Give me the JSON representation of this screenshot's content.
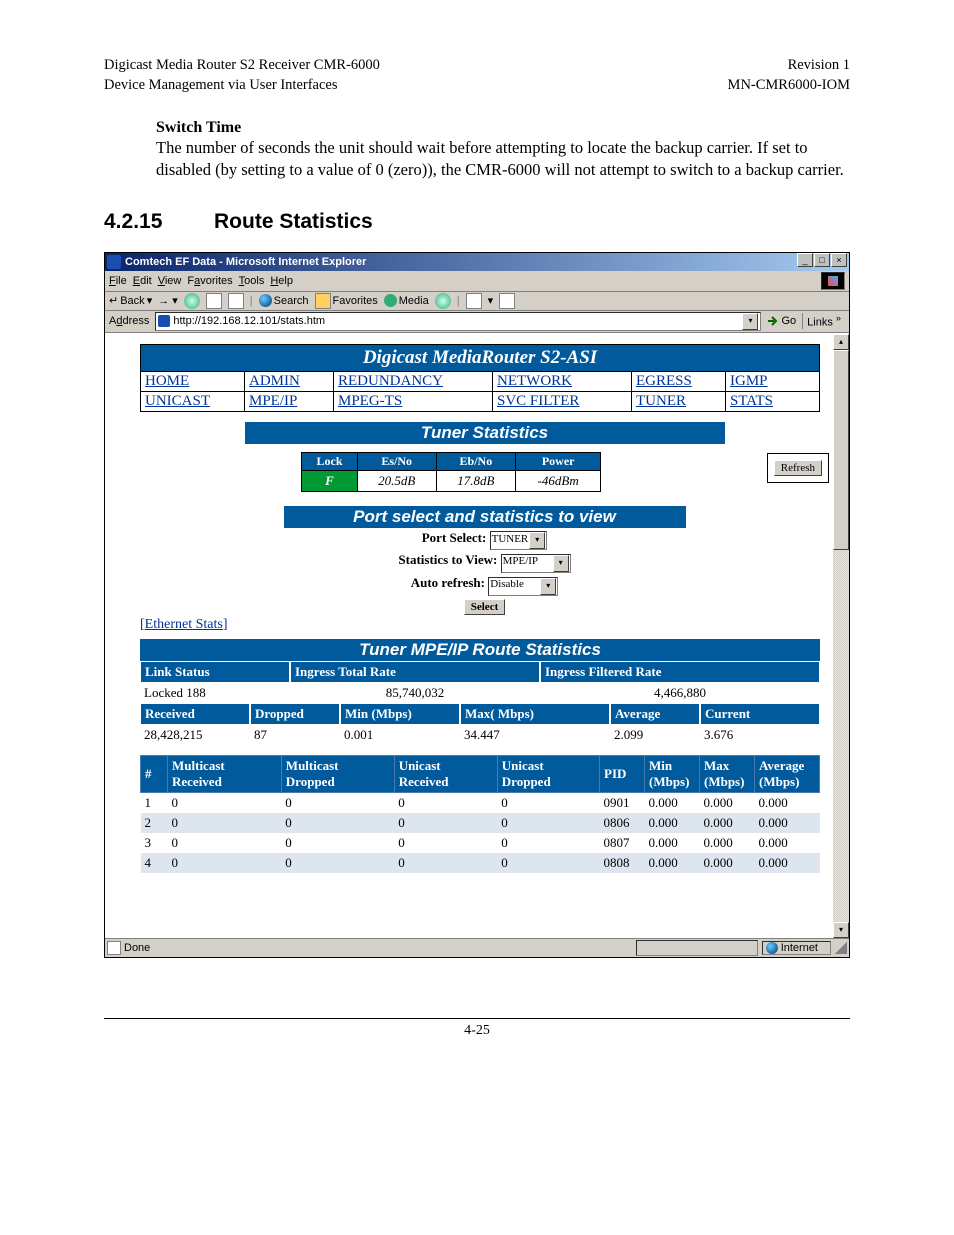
{
  "header": {
    "l1": "Digicast Media Router S2 Receiver CMR-6000",
    "l2": "Device Management via User Interfaces",
    "r1": "Revision 1",
    "r2": "MN-CMR6000-IOM"
  },
  "switch": {
    "title": "Switch Time",
    "body": "The number of seconds the unit should wait before attempting to locate the backup carrier. If set to disabled (by setting to a value of 0 (zero)), the CMR-6000 will not attempt to switch to a backup carrier."
  },
  "section": {
    "num": "4.2.15",
    "title": "Route Statistics"
  },
  "win": {
    "title": "Comtech EF Data - Microsoft Internet Explorer",
    "min": "_",
    "max": "□",
    "close": "×"
  },
  "menu": {
    "file": "File",
    "edit": "Edit",
    "view": "View",
    "fav": "Favorites",
    "tools": "Tools",
    "help": "Help"
  },
  "tb": {
    "back": "Back",
    "search": "Search",
    "fav": "Favorites",
    "media": "Media"
  },
  "addr": {
    "label": "Address",
    "url": "http://192.168.12.101/stats.htm",
    "go": "Go",
    "links": "Links"
  },
  "nav": {
    "title": "Digicast MediaRouter S2-ASI",
    "r1": [
      "HOME",
      "ADMIN",
      "REDUNDANCY",
      "NETWORK",
      "EGRESS",
      "IGMP"
    ],
    "r2": [
      "UNICAST",
      "MPE/IP",
      "MPEG-TS",
      "SVC FILTER",
      "TUNER",
      "STATS"
    ]
  },
  "tuner": {
    "title": "Tuner Statistics",
    "h": [
      "Lock",
      "Es/No",
      "Eb/No",
      "Power"
    ],
    "v": [
      "F",
      "20.5dB",
      "17.8dB",
      "-46dBm"
    ],
    "refresh": "Refresh"
  },
  "portsel": {
    "title": "Port select and statistics to view",
    "l1": "Port Select:",
    "v1": "TUNER",
    "l2": "Statistics to View:",
    "v2": "MPE/IP",
    "l3": "Auto refresh:",
    "v3": "Disable",
    "btn": "Select"
  },
  "ethlink": "Ethernet Stats",
  "routestats": {
    "title": "Tuner MPE/IP Route Statistics",
    "r1h": [
      "Link Status",
      "Ingress Total Rate",
      "Ingress Filtered Rate"
    ],
    "r1v": [
      "Locked 188",
      "85,740,032",
      "4,466,880"
    ],
    "r2h": [
      "Received",
      "Dropped",
      "Min (Mbps)",
      "Max( Mbps)",
      "Average",
      "Current"
    ],
    "r2v": [
      "28,428,215",
      "87",
      "0.001",
      "34.447",
      "2.099",
      "3.676"
    ]
  },
  "pid": {
    "h": [
      "#",
      "Multicast Received",
      "Multicast Dropped",
      "Unicast Received",
      "Unicast Dropped",
      "PID",
      "Min (Mbps)",
      "Max (Mbps)",
      "Average (Mbps)"
    ],
    "rows": [
      [
        "1",
        "0",
        "0",
        "0",
        "0",
        "0901",
        "0.000",
        "0.000",
        "0.000"
      ],
      [
        "2",
        "0",
        "0",
        "0",
        "0",
        "0806",
        "0.000",
        "0.000",
        "0.000"
      ],
      [
        "3",
        "0",
        "0",
        "0",
        "0",
        "0807",
        "0.000",
        "0.000",
        "0.000"
      ],
      [
        "4",
        "0",
        "0",
        "0",
        "0",
        "0808",
        "0.000",
        "0.000",
        "0.000"
      ]
    ]
  },
  "status": {
    "done": "Done",
    "zone": "Internet"
  },
  "footer": "4-25"
}
